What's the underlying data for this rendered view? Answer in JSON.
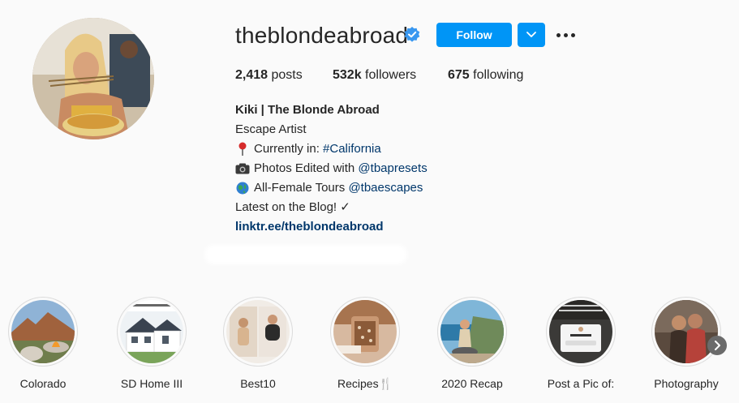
{
  "profile": {
    "username": "theblondeabroad",
    "follow_label": "Follow",
    "stats": {
      "posts_count": "2,418",
      "posts_label": " posts",
      "followers_count": "532k",
      "followers_label": " followers",
      "following_count": "675",
      "following_label": " following"
    },
    "bio": {
      "name": "Kiki | The Blonde Abroad",
      "line1": "Escape Artist",
      "line2_prefix": "Currently in: ",
      "line2_link": "#California",
      "line3_prefix": "Photos Edited with ",
      "line3_link": "@tbapresets",
      "line4_prefix": "All-Female Tours ",
      "line4_link": "@tbaescapes",
      "line5": "Latest on the Blog! ✓",
      "website": "linktr.ee/theblondeabroad"
    }
  },
  "highlights": [
    {
      "label": "Colorado"
    },
    {
      "label": "SD Home III"
    },
    {
      "label": "Best10"
    },
    {
      "label": "Recipes🍴"
    },
    {
      "label": "2020 Recap"
    },
    {
      "label": "Post a Pic of:"
    },
    {
      "label": "Photography"
    }
  ],
  "colors": {
    "accent": "#0095f6",
    "link": "#00376b",
    "verified": "#3897f0",
    "text": "#262626",
    "background": "#fafafa"
  },
  "icons": [
    "verified-badge-icon",
    "chevron-down-icon",
    "more-options-icon",
    "pin-icon",
    "camera-icon",
    "globe-icon",
    "chevron-right-icon"
  ]
}
